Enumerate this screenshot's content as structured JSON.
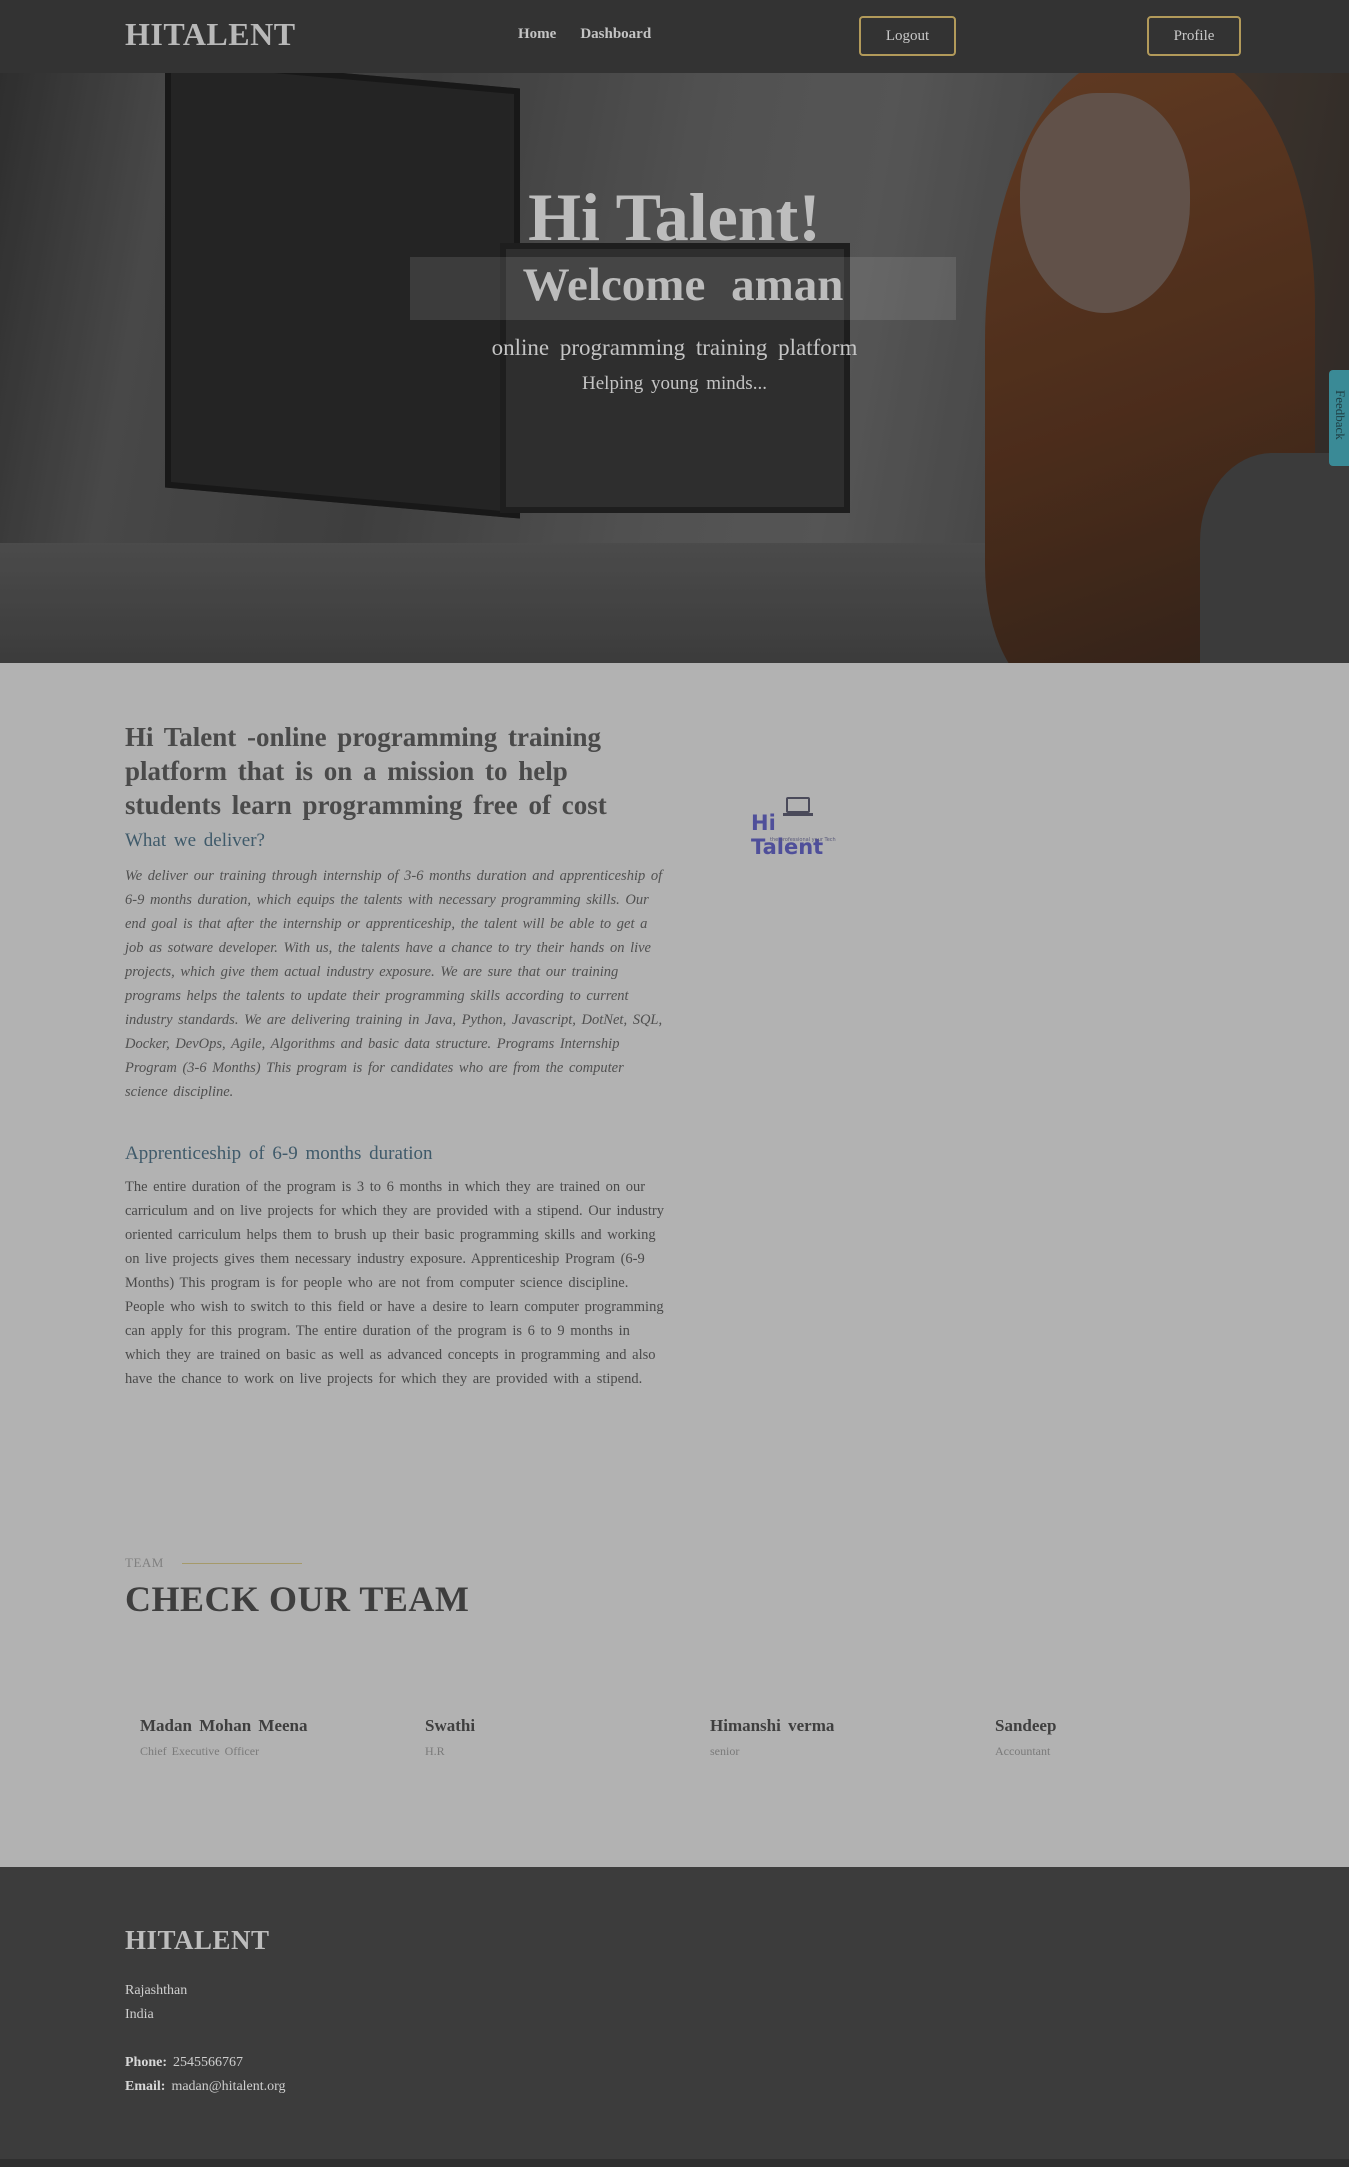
{
  "header": {
    "logo": "HITALENT",
    "nav": [
      {
        "label": "Home"
      },
      {
        "label": "Dashboard"
      }
    ],
    "logout_label": "Logout",
    "profile_label": "Profile"
  },
  "hero": {
    "title": "Hi Talent!",
    "welcome": "Welcome   aman",
    "tagline": "online  programming   training  platform",
    "subtagline": "Helping  young  minds...",
    "feedback_label": "Feedback"
  },
  "about": {
    "title": "Hi Talent -online   programming   training  platform  that is  on  a  mission   to  help  students   learn  programming   free  of cost",
    "deliver_heading": "What  we  deliver?",
    "deliver_text": "We  deliver  our training through  internship  of 3-6 months  duration and  apprenticeship   of 6-9 months  duration,  which equips  the talents  with  necessary   programming  skills.  Our end  goal is that after the internship  or  apprenticeship,   the talent will be  able  to get  a job as sotware  developer.  With  us,  the talents  have  a chance  to try their hands  on live projects,  which give  them  actual  industry  exposure.   We  are sure  that our training programs  helps  the talents  to update  their programming  skills according  to current  industry  standards.   We  are delivering  training in Java,  Python,  Javascript,  DotNet,  SQL,  Docker,  DevOps,  Agile, Algorithms  and basic  data structure.  Programs  Internship  Program  (3-6 Months)  This program  is for candidates   who  are  from  the  computer   science   discipline.",
    "appr_heading": "Apprenticeship   of 6-9 months   duration",
    "appr_text": "The  entire  duration  of the program  is 3 to 6 months   in which  they  are  trained  on our  carriculum  and  on live projects   for which  they  are  provided   with a  stipend.   Our  industry  oriented  carriculum  helps  them  to brush  up their basic  programming   skills and  working  on live projects  gives  them  necessary   industry  exposure.   Apprenticeship   Program   (6-9 Months)  This program   is for  people   who  are  not from computer   science   discipline.  People   who wish to  switch  to this field or have  a  desire   to learn  computer   programming   can  apply  for this program.   The  entire  duration  of the program  is 6 to 9 months   in which  they  are  trained  on basic  as  well as  advanced    concepts    in programming   and  also  have  the  chance   to work on live projects  for which they  are  provided  with a  stipend.",
    "brand_name": "Hi Talent",
    "brand_tagline": "the professional your Tech"
  },
  "team": {
    "label": "TEAM",
    "title": "CHECK OUR TEAM",
    "members": [
      {
        "name": "Madan  Mohan  Meena",
        "role": "Chief Executive  Officer"
      },
      {
        "name": "Swathi",
        "role": "H.R"
      },
      {
        "name": "Himanshi   verma",
        "role": "senior"
      },
      {
        "name": "Sandeep",
        "role": "Accountant"
      }
    ]
  },
  "footer": {
    "logo": "HITALENT",
    "address_line1": "Rajashthan",
    "address_line2": "India",
    "phone_label": "Phone:",
    "phone": "2545566767",
    "email_label": "Email:",
    "email": "madan@hitalent.org"
  }
}
